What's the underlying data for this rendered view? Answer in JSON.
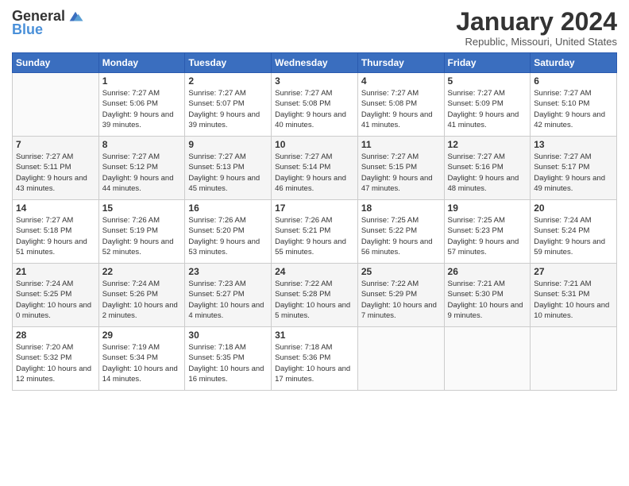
{
  "logo": {
    "text_general": "General",
    "text_blue": "Blue"
  },
  "header": {
    "title": "January 2024",
    "subtitle": "Republic, Missouri, United States"
  },
  "weekdays": [
    "Sunday",
    "Monday",
    "Tuesday",
    "Wednesday",
    "Thursday",
    "Friday",
    "Saturday"
  ],
  "weeks": [
    [
      {
        "day": "",
        "sunrise": "",
        "sunset": "",
        "daylight": ""
      },
      {
        "day": "1",
        "sunrise": "Sunrise: 7:27 AM",
        "sunset": "Sunset: 5:06 PM",
        "daylight": "Daylight: 9 hours and 39 minutes."
      },
      {
        "day": "2",
        "sunrise": "Sunrise: 7:27 AM",
        "sunset": "Sunset: 5:07 PM",
        "daylight": "Daylight: 9 hours and 39 minutes."
      },
      {
        "day": "3",
        "sunrise": "Sunrise: 7:27 AM",
        "sunset": "Sunset: 5:08 PM",
        "daylight": "Daylight: 9 hours and 40 minutes."
      },
      {
        "day": "4",
        "sunrise": "Sunrise: 7:27 AM",
        "sunset": "Sunset: 5:08 PM",
        "daylight": "Daylight: 9 hours and 41 minutes."
      },
      {
        "day": "5",
        "sunrise": "Sunrise: 7:27 AM",
        "sunset": "Sunset: 5:09 PM",
        "daylight": "Daylight: 9 hours and 41 minutes."
      },
      {
        "day": "6",
        "sunrise": "Sunrise: 7:27 AM",
        "sunset": "Sunset: 5:10 PM",
        "daylight": "Daylight: 9 hours and 42 minutes."
      }
    ],
    [
      {
        "day": "7",
        "sunrise": "Sunrise: 7:27 AM",
        "sunset": "Sunset: 5:11 PM",
        "daylight": "Daylight: 9 hours and 43 minutes."
      },
      {
        "day": "8",
        "sunrise": "Sunrise: 7:27 AM",
        "sunset": "Sunset: 5:12 PM",
        "daylight": "Daylight: 9 hours and 44 minutes."
      },
      {
        "day": "9",
        "sunrise": "Sunrise: 7:27 AM",
        "sunset": "Sunset: 5:13 PM",
        "daylight": "Daylight: 9 hours and 45 minutes."
      },
      {
        "day": "10",
        "sunrise": "Sunrise: 7:27 AM",
        "sunset": "Sunset: 5:14 PM",
        "daylight": "Daylight: 9 hours and 46 minutes."
      },
      {
        "day": "11",
        "sunrise": "Sunrise: 7:27 AM",
        "sunset": "Sunset: 5:15 PM",
        "daylight": "Daylight: 9 hours and 47 minutes."
      },
      {
        "day": "12",
        "sunrise": "Sunrise: 7:27 AM",
        "sunset": "Sunset: 5:16 PM",
        "daylight": "Daylight: 9 hours and 48 minutes."
      },
      {
        "day": "13",
        "sunrise": "Sunrise: 7:27 AM",
        "sunset": "Sunset: 5:17 PM",
        "daylight": "Daylight: 9 hours and 49 minutes."
      }
    ],
    [
      {
        "day": "14",
        "sunrise": "Sunrise: 7:27 AM",
        "sunset": "Sunset: 5:18 PM",
        "daylight": "Daylight: 9 hours and 51 minutes."
      },
      {
        "day": "15",
        "sunrise": "Sunrise: 7:26 AM",
        "sunset": "Sunset: 5:19 PM",
        "daylight": "Daylight: 9 hours and 52 minutes."
      },
      {
        "day": "16",
        "sunrise": "Sunrise: 7:26 AM",
        "sunset": "Sunset: 5:20 PM",
        "daylight": "Daylight: 9 hours and 53 minutes."
      },
      {
        "day": "17",
        "sunrise": "Sunrise: 7:26 AM",
        "sunset": "Sunset: 5:21 PM",
        "daylight": "Daylight: 9 hours and 55 minutes."
      },
      {
        "day": "18",
        "sunrise": "Sunrise: 7:25 AM",
        "sunset": "Sunset: 5:22 PM",
        "daylight": "Daylight: 9 hours and 56 minutes."
      },
      {
        "day": "19",
        "sunrise": "Sunrise: 7:25 AM",
        "sunset": "Sunset: 5:23 PM",
        "daylight": "Daylight: 9 hours and 57 minutes."
      },
      {
        "day": "20",
        "sunrise": "Sunrise: 7:24 AM",
        "sunset": "Sunset: 5:24 PM",
        "daylight": "Daylight: 9 hours and 59 minutes."
      }
    ],
    [
      {
        "day": "21",
        "sunrise": "Sunrise: 7:24 AM",
        "sunset": "Sunset: 5:25 PM",
        "daylight": "Daylight: 10 hours and 0 minutes."
      },
      {
        "day": "22",
        "sunrise": "Sunrise: 7:24 AM",
        "sunset": "Sunset: 5:26 PM",
        "daylight": "Daylight: 10 hours and 2 minutes."
      },
      {
        "day": "23",
        "sunrise": "Sunrise: 7:23 AM",
        "sunset": "Sunset: 5:27 PM",
        "daylight": "Daylight: 10 hours and 4 minutes."
      },
      {
        "day": "24",
        "sunrise": "Sunrise: 7:22 AM",
        "sunset": "Sunset: 5:28 PM",
        "daylight": "Daylight: 10 hours and 5 minutes."
      },
      {
        "day": "25",
        "sunrise": "Sunrise: 7:22 AM",
        "sunset": "Sunset: 5:29 PM",
        "daylight": "Daylight: 10 hours and 7 minutes."
      },
      {
        "day": "26",
        "sunrise": "Sunrise: 7:21 AM",
        "sunset": "Sunset: 5:30 PM",
        "daylight": "Daylight: 10 hours and 9 minutes."
      },
      {
        "day": "27",
        "sunrise": "Sunrise: 7:21 AM",
        "sunset": "Sunset: 5:31 PM",
        "daylight": "Daylight: 10 hours and 10 minutes."
      }
    ],
    [
      {
        "day": "28",
        "sunrise": "Sunrise: 7:20 AM",
        "sunset": "Sunset: 5:32 PM",
        "daylight": "Daylight: 10 hours and 12 minutes."
      },
      {
        "day": "29",
        "sunrise": "Sunrise: 7:19 AM",
        "sunset": "Sunset: 5:34 PM",
        "daylight": "Daylight: 10 hours and 14 minutes."
      },
      {
        "day": "30",
        "sunrise": "Sunrise: 7:18 AM",
        "sunset": "Sunset: 5:35 PM",
        "daylight": "Daylight: 10 hours and 16 minutes."
      },
      {
        "day": "31",
        "sunrise": "Sunrise: 7:18 AM",
        "sunset": "Sunset: 5:36 PM",
        "daylight": "Daylight: 10 hours and 17 minutes."
      },
      {
        "day": "",
        "sunrise": "",
        "sunset": "",
        "daylight": ""
      },
      {
        "day": "",
        "sunrise": "",
        "sunset": "",
        "daylight": ""
      },
      {
        "day": "",
        "sunrise": "",
        "sunset": "",
        "daylight": ""
      }
    ]
  ]
}
